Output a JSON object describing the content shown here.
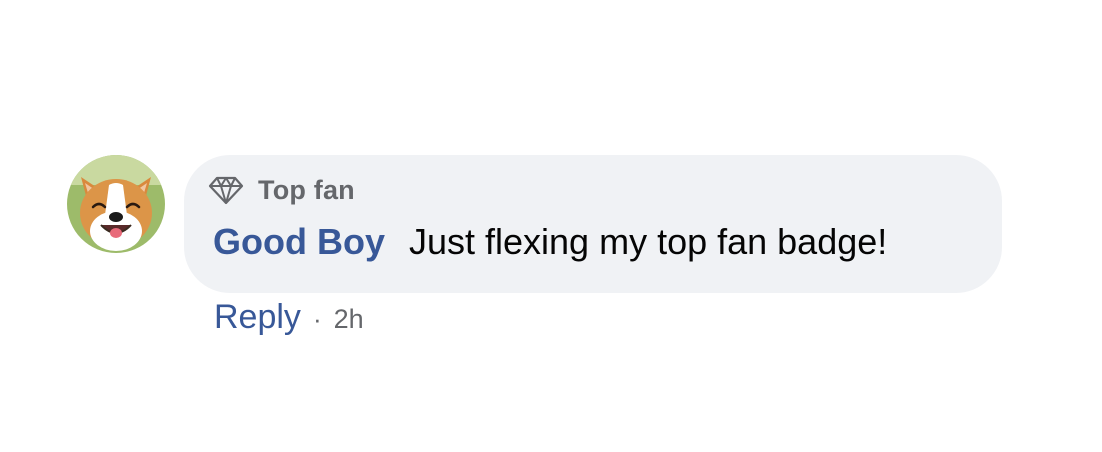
{
  "comment": {
    "badge": {
      "icon": "diamond-icon",
      "label": "Top fan"
    },
    "author": "Good Boy",
    "text": "Just flexing my top fan badge!",
    "actions": {
      "reply_label": "Reply",
      "separator": "·",
      "timestamp": "2h"
    },
    "avatar": {
      "icon": "corgi-avatar"
    }
  },
  "colors": {
    "bubble_bg": "#f0f2f5",
    "link": "#385898",
    "meta": "#65676b",
    "text": "#050505"
  }
}
